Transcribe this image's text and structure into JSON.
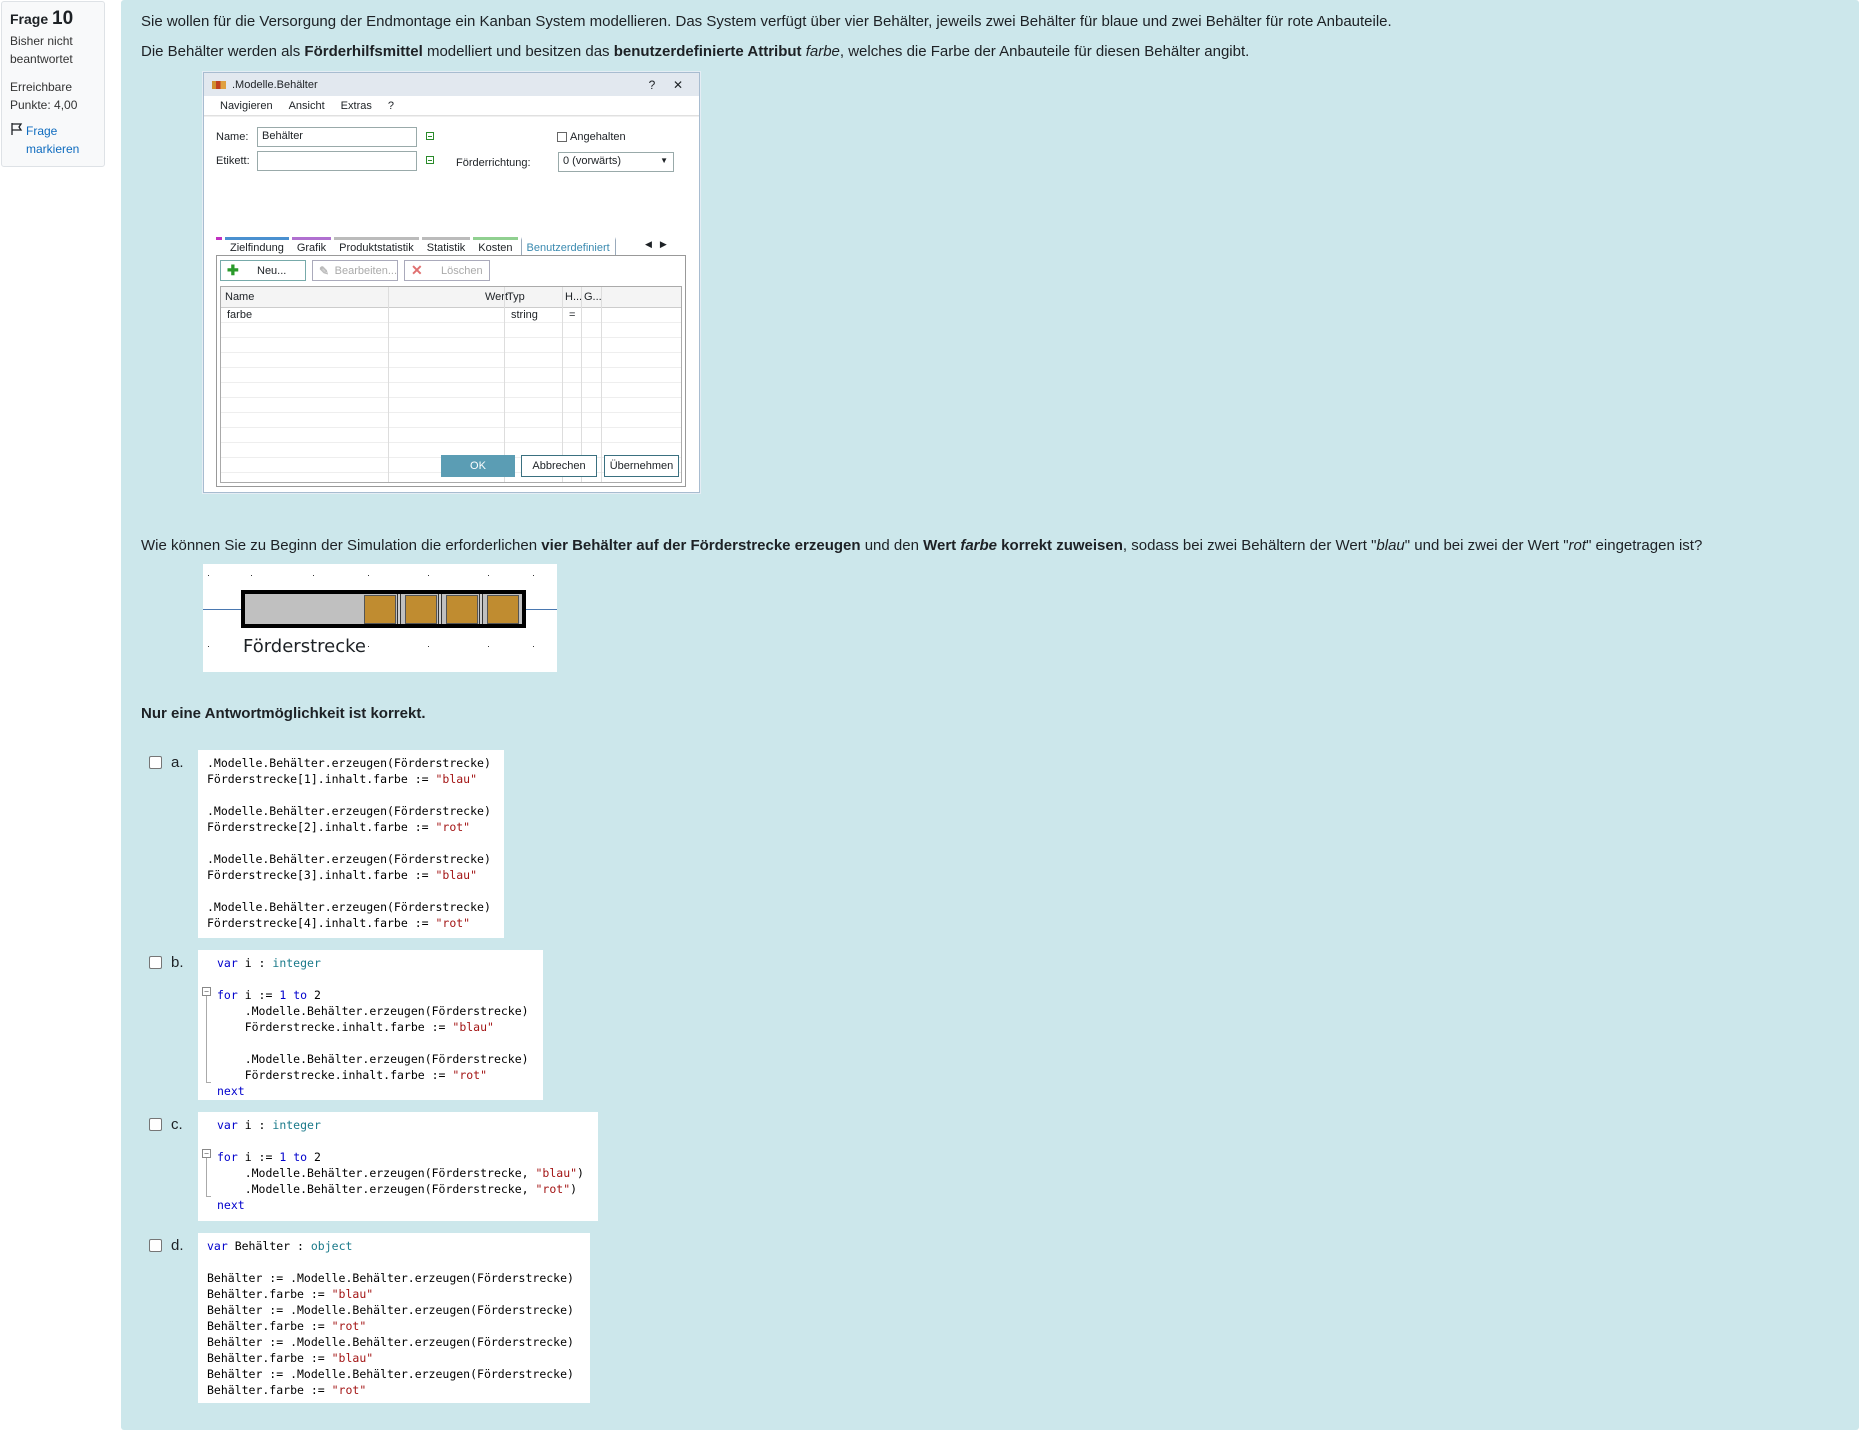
{
  "info": {
    "frage_label": "Frage",
    "frage_number": "10",
    "status": "Bisher nicht beantwortet",
    "points": "Erreichbare Punkte: 4,00",
    "flag_label": "Frage markieren"
  },
  "question": {
    "intro1": "Sie wollen für die Versorgung der Endmontage ein Kanban System modellieren. Das System verfügt über vier Behälter, jeweils zwei Behälter für blaue und zwei Behälter für rote Anbauteile.",
    "intro2_a": "Die Behälter werden als ",
    "intro2_b": "Förderhilfsmittel",
    "intro2_c": " modelliert und besitzen das ",
    "intro2_d": "benutzerdefinierte Attribut",
    "intro2_e": "farbe",
    "intro2_f": ", welches die Farbe der Anbauteile für diesen Behälter angibt.",
    "q_a": "Wie können Sie zu Beginn der Simulation die erforderlichen ",
    "q_b": "vier Behälter auf der Förderstrecke erzeugen",
    "q_c": " und den ",
    "q_d": "Wert ",
    "q_e": "farbe",
    "q_f": " korrekt zuweisen",
    "q_g": ", sodass bei zwei Behältern der Wert \"",
    "q_h": "blau",
    "q_i": "\" und bei zwei der Wert \"",
    "q_j": "rot",
    "q_k": "\" eingetragen ist?",
    "instruction": "Nur eine Antwortmöglichkeit ist korrekt."
  },
  "dialog": {
    "title": ".Modelle.Behälter",
    "help": "?",
    "close": "✕",
    "menu": [
      "Navigieren",
      "Ansicht",
      "Extras",
      "?"
    ],
    "name_label": "Name:",
    "name_value": "Behälter",
    "etikett_label": "Etikett:",
    "angehalten_label": "Angehalten",
    "foerderrichtung_label": "Förderrichtung:",
    "foerderrichtung_value": "0 (vorwärts)",
    "tabs": [
      "Zielfindung",
      "Grafik",
      "Produktstatistik",
      "Statistik",
      "Kosten",
      "Benutzerdefiniert"
    ],
    "btn_new": "Neu...",
    "btn_edit": "Bearbeiten...",
    "btn_delete": "Löschen",
    "grid_headers": [
      "Name",
      "Wert",
      "Typ",
      "H...",
      "G..."
    ],
    "grid_row": {
      "name": "farbe",
      "wert": "",
      "typ": "string",
      "h": "="
    },
    "btn_ok": "OK",
    "btn_cancel": "Abbrechen",
    "btn_apply": "Übernehmen"
  },
  "conveyor": {
    "label": "Förderstrecke"
  },
  "options": [
    {
      "letter": "a."
    },
    {
      "letter": "b."
    },
    {
      "letter": "c."
    },
    {
      "letter": "d."
    }
  ],
  "colors": {
    "content_bg": "#cce7eb",
    "link": "#0f6cbf",
    "box": "#c08c30",
    "ok_button": "#5b9db4"
  }
}
